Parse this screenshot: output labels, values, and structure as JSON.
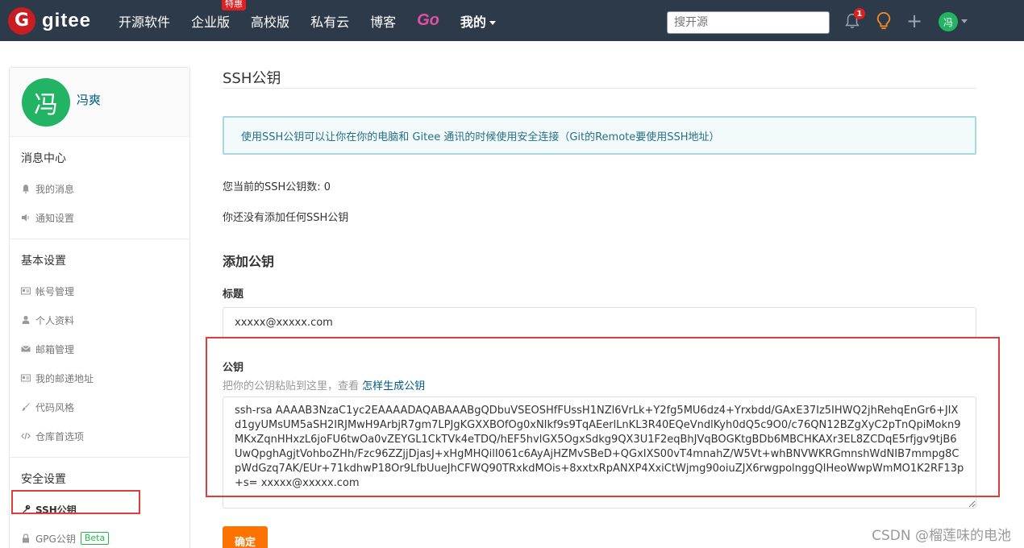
{
  "header": {
    "logo_glyph": "G",
    "logo_text": "gitee",
    "nav": [
      "开源软件",
      "企业版",
      "高校版",
      "私有云",
      "博客",
      "Go",
      "我的"
    ],
    "hot_badge": "特惠",
    "search_placeholder": "搜开源",
    "notification_count": "1",
    "plus_glyph": "+",
    "avatar_char": "冯"
  },
  "sidebar": {
    "avatar_char": "冯",
    "user_name": "冯爽",
    "sections": [
      {
        "title": "消息中心",
        "items": [
          "我的消息",
          "通知设置"
        ]
      },
      {
        "title": "基本设置",
        "items": [
          "帐号管理",
          "个人资料",
          "邮箱管理",
          "我的邮递地址",
          "代码风格",
          "仓库首选项"
        ]
      },
      {
        "title": "安全设置",
        "items": [
          "SSH公钥",
          "GPG公钥"
        ]
      }
    ],
    "beta_label": "Beta"
  },
  "main": {
    "title": "SSH公钥",
    "info": "使用SSH公钥可以让你在你的电脑和 Gitee 通讯的时候使用安全连接（Git的Remote要使用SSH地址）",
    "count_text": "您当前的SSH公钥数: 0",
    "none_text": "你还没有添加任何SSH公钥",
    "add_title": "添加公钥",
    "label_title": "标题",
    "title_value": "xxxxx@xxxxx.com",
    "label_key": "公钥",
    "hint_text": "把你的公钥粘贴到这里，查看 ",
    "hint_link": "怎样生成公钥",
    "key_value": "ssh-rsa AAAAB3NzaC1yc2EAAAADAQABAAABgQDbuVSEOSHfFUssH1NZl6VrLk+Y2fg5MU6dz4+Yrxbdd/GAxE37Iz5IHWQ2jhRehqEnGr6+JIXd1gyUMsUM5aSH2IRJMwH9ArbjR7gm7LPJgKGXXBOfOg0xNIkf9s9TqAEerlLnKL3R40EQeVndlKyh0dQ5c9O0/c76QN12BZgXyC2pTnQpiMokn9MKxZqnHHxzL6joFU6twOa0vZEYGL1CkTVk4eTDQ/hEF5hvlGX5OgxSdkg9QX3U1F2eqBhJVqBOGKtgBDb6MBCHKAXr3EL8ZCDqE5rfjgv9tjB6UwQpghAgjtVohboZHh/Fzc96ZZjjDjasJ+xHgMHQilI061c6AyAjHZMvSBeD+QGxIXS00vT4mnahZ/W5Vt+whBNVWKRGmnshWdNIB7mmpg8CpWdGzq7AK/EUr+71kdhwP18Or9LfbUueJhCFWQ90TRxkdMOis+8xxtxRpANXP4XxiCtWjmg90oiuZJX6rwgpolnggQIHeoWwpWmMO1K2RF13p+s= xxxxx@xxxxx.com",
    "submit_label": "确定"
  },
  "watermark": "CSDN @榴莲味的电池"
}
